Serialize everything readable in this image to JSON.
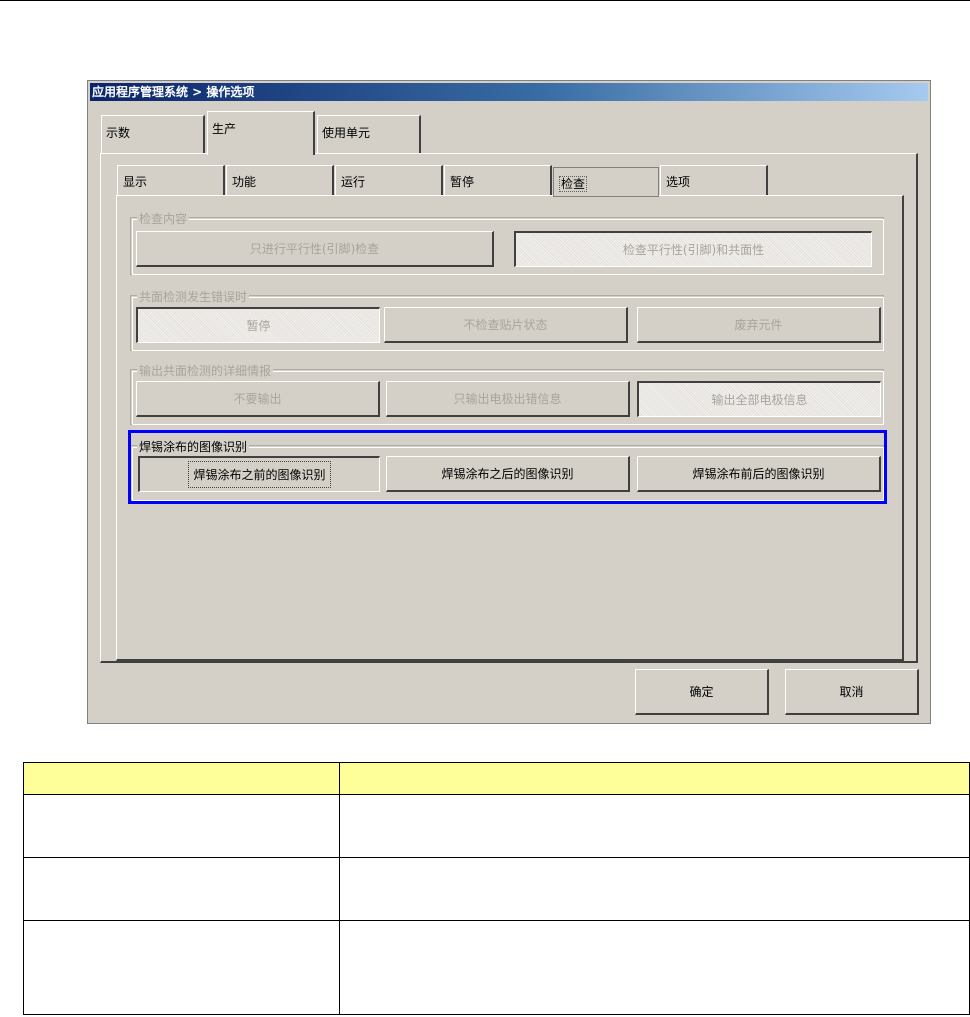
{
  "window": {
    "title": "应用程序管理系统 > 操作选项"
  },
  "tabs": [
    "示数",
    "生产",
    "使用单元"
  ],
  "active_tab": "生产",
  "subtabs": [
    "显示",
    "功能",
    "运行",
    "暂停",
    "检查",
    "选项"
  ],
  "active_subtab": "检查",
  "groups": {
    "inspection_content": {
      "legend": "检查内容",
      "buttons": [
        "只进行平行性(引脚)检查",
        "检查平行性(引脚)和共面性"
      ]
    },
    "coplanarity_error": {
      "legend": "共面检测发生错误时",
      "buttons": [
        "暂停",
        "不检查贴片状态",
        "废弃元件"
      ]
    },
    "coplanarity_detail": {
      "legend": "输出共面检测的详细情报",
      "buttons": [
        "不要输出",
        "只输出电极出错信息",
        "输出全部电极信息"
      ]
    },
    "solder_image": {
      "legend": "焊锡涂布的图像识别",
      "buttons": [
        "焊锡涂布之前的图像识别",
        "焊锡涂布之后的图像识别",
        "焊锡涂布前后的图像识别"
      ]
    }
  },
  "dialog_buttons": {
    "ok": "确定",
    "cancel": "取消"
  },
  "colors": {
    "highlight": "#0000ff",
    "table_header": "#ffff99",
    "title_gradient_start": "#0a246a"
  }
}
